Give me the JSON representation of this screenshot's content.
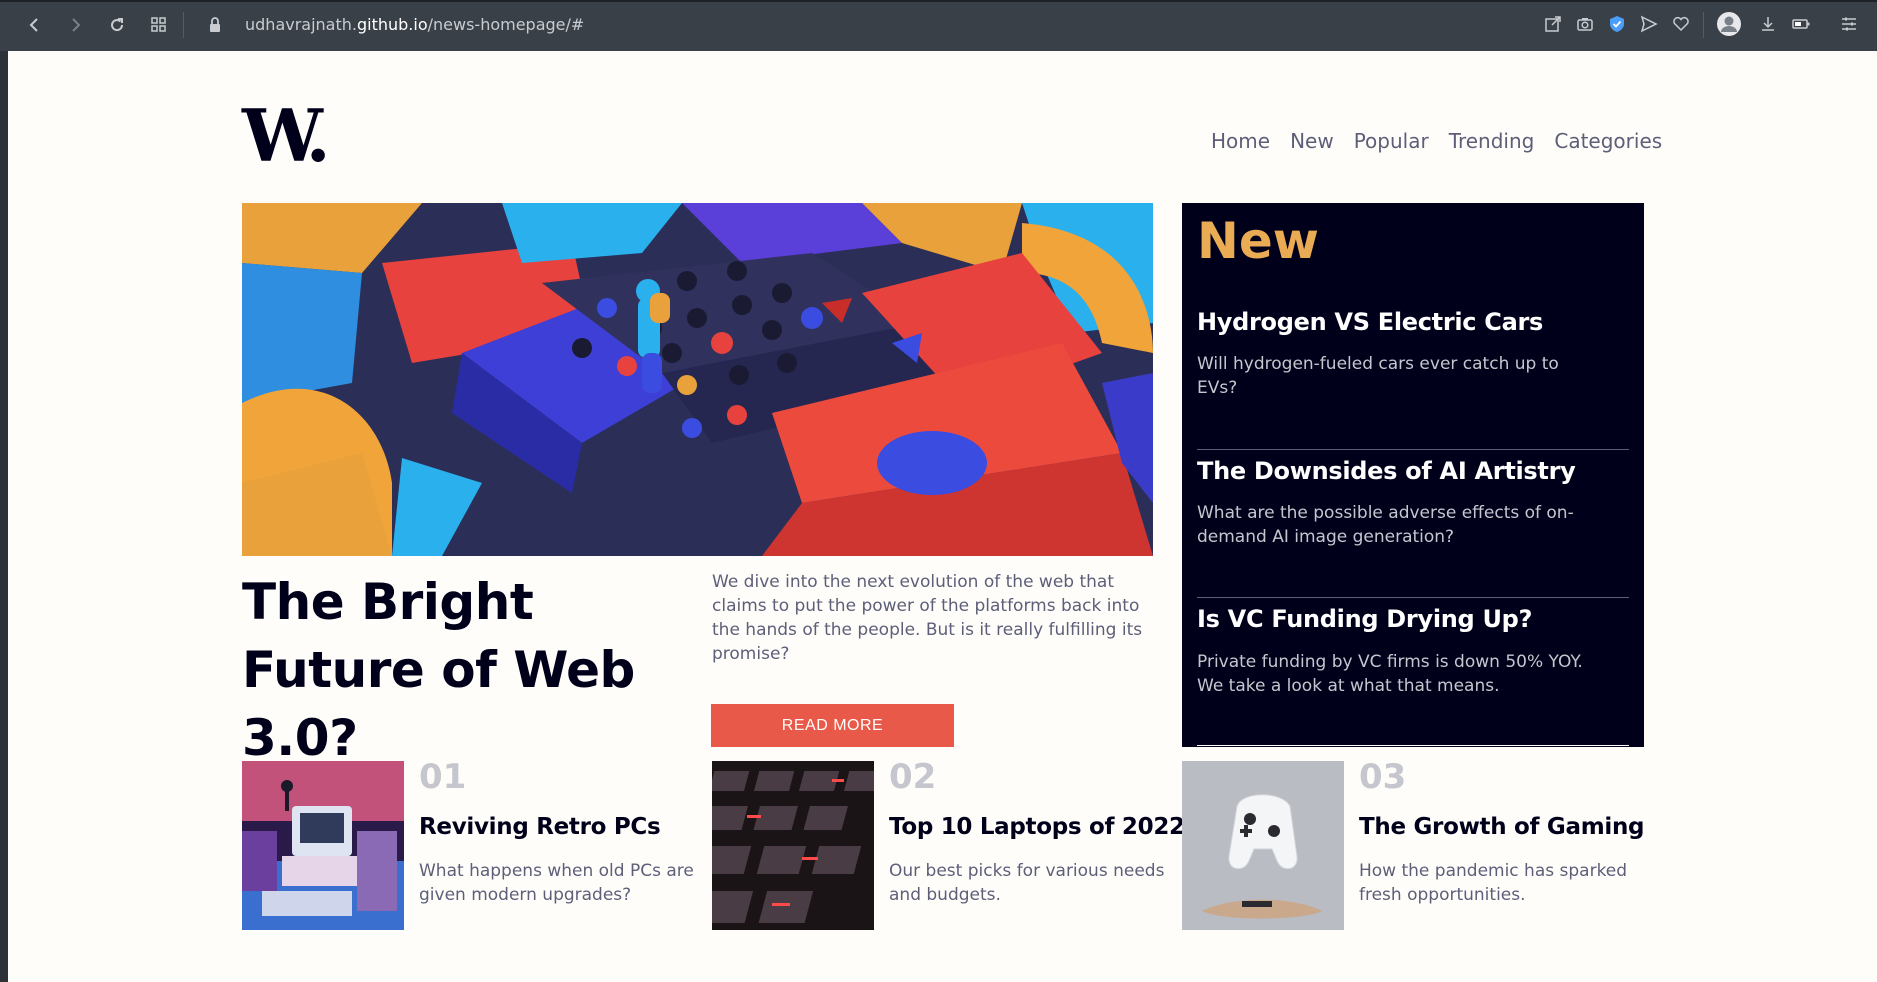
{
  "browser": {
    "url_prefix": "udhavrajnath.",
    "url_domain": "github.io",
    "url_path": "/news-homepage/#"
  },
  "site": {
    "logo": "W.",
    "nav": [
      "Home",
      "New",
      "Popular",
      "Trending",
      "Categories"
    ]
  },
  "hero": {
    "title": "The Bright Future of Web 3.0?",
    "description": "We dive into the next evolution of the web that claims to put the power of the platforms back into the hands of the people. But is it really fulfilling its promise?",
    "button_label": "READ MORE"
  },
  "new_panel": {
    "heading": "New",
    "items": [
      {
        "title": "Hydrogen VS Electric Cars",
        "description": "Will hydrogen-fueled cars ever catch up to EVs?"
      },
      {
        "title": "The Downsides of AI Artistry",
        "description": "What are the possible adverse effects of on-demand AI image generation?"
      },
      {
        "title": "Is VC Funding Drying Up?",
        "description": "Private funding by VC firms is down 50% YOY. We take a look at what that means."
      }
    ]
  },
  "cards": [
    {
      "number": "01",
      "title": "Reviving Retro PCs",
      "description": "What happens when old PCs are given modern upgrades?"
    },
    {
      "number": "02",
      "title": "Top 10 Laptops of 2022",
      "description": "Our best picks for various needs and budgets."
    },
    {
      "number": "03",
      "title": "The Growth of Gaming",
      "description": "How the pandemic has sparked fresh opportunities."
    }
  ],
  "colors": {
    "accent_red": "#e9594a",
    "accent_orange": "#e9ab53",
    "dark_blue": "#00001a",
    "grayish_blue": "#5d5f79",
    "off_white": "#fffdfa"
  }
}
